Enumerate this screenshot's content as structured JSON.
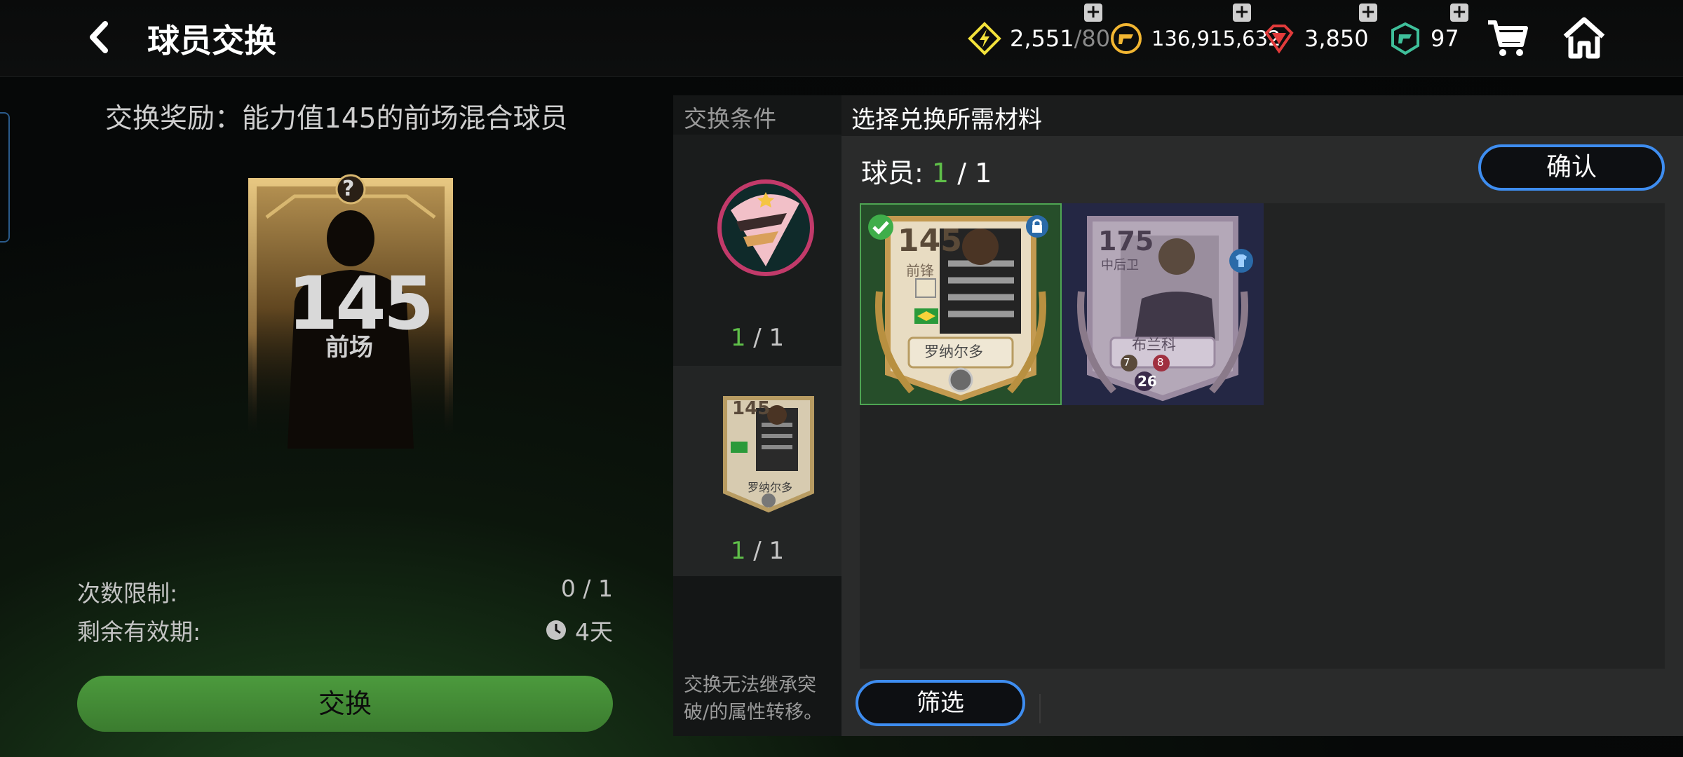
{
  "header": {
    "title": "球员交换",
    "resources": [
      {
        "name": "energy",
        "value": "2,551",
        "max": "/80",
        "color": "#f3e23b"
      },
      {
        "name": "coins",
        "value": "136,915,632",
        "color": "#f2b632"
      },
      {
        "name": "gems",
        "value": "3,850",
        "color": "#e23b3b"
      },
      {
        "name": "tokens",
        "value": "97",
        "color": "#3fbf9a"
      }
    ]
  },
  "reward": {
    "title": "交换奖励：能力值145的前场混合球员",
    "card_rating": "145",
    "card_position": "前场",
    "card_mystery": "?"
  },
  "limits": {
    "count_label": "次数限制:",
    "count_value": "0 / 1",
    "valid_label": "剩余有效期:",
    "valid_value": "4天"
  },
  "exchange_button": "交换",
  "conditions": {
    "header": "交换条件",
    "slot1": {
      "current": "1",
      "total": "/ 1"
    },
    "slot2": {
      "current": "1",
      "total": "/ 1",
      "rating": "145",
      "name": "罗纳尔多"
    },
    "note": "交换无法继承突破/的属性转移。"
  },
  "material_panel": {
    "title": "选择兑换所需材料",
    "players_label": "球员:",
    "players_current": "1",
    "players_total": "/ 1",
    "confirm": "确认",
    "filter": "筛选",
    "cards": [
      {
        "rating": "145",
        "position": "前锋",
        "name": "罗纳尔多",
        "selected": true,
        "locked": true
      },
      {
        "rating": "175",
        "position": "中后卫",
        "name": "布兰科",
        "level": "26",
        "badge_a": "7",
        "badge_b": "8",
        "selected": false
      }
    ]
  }
}
